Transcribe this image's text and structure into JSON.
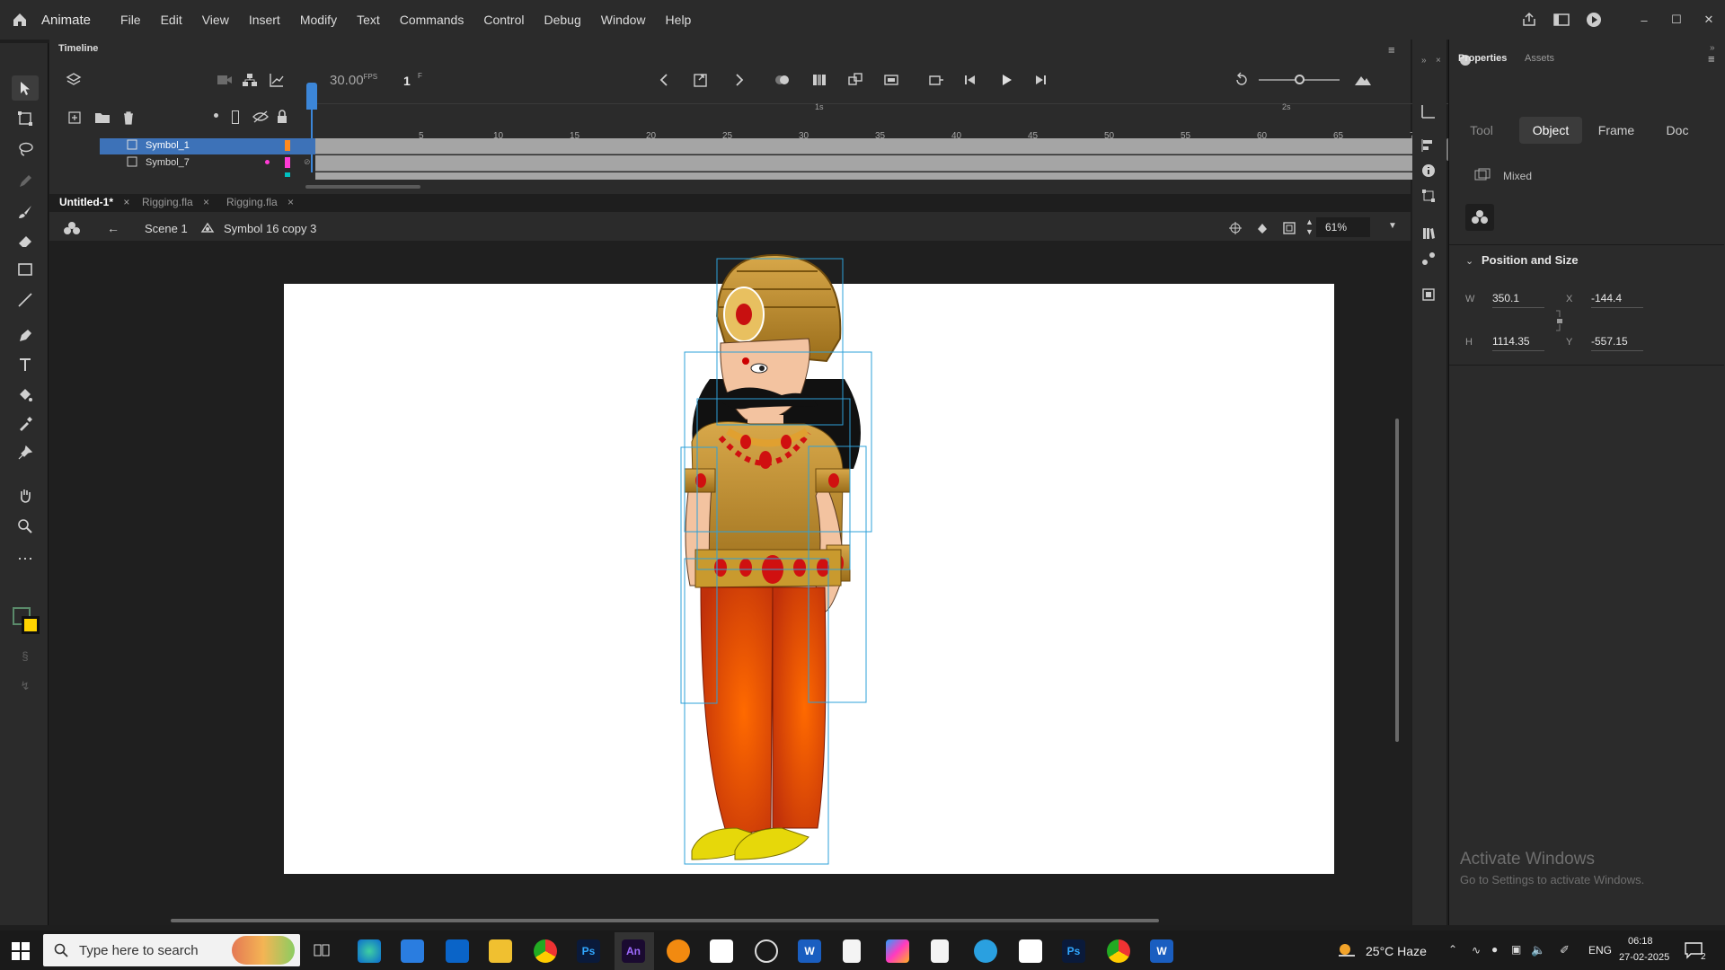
{
  "app": {
    "name": "Animate"
  },
  "menu": [
    "File",
    "Edit",
    "View",
    "Insert",
    "Modify",
    "Text",
    "Commands",
    "Control",
    "Debug",
    "Window",
    "Help"
  ],
  "timeline": {
    "panel_title": "Timeline",
    "fps": "30.00",
    "fps_unit": "FPS",
    "frame": "1",
    "frame_unit": "F",
    "ruler": [
      "5",
      "10",
      "15",
      "20",
      "25",
      "30",
      "35",
      "40",
      "45",
      "50",
      "55",
      "60",
      "65",
      "70"
    ],
    "seconds": [
      "1s",
      "2s"
    ],
    "layers": [
      {
        "name": "Symbol_1",
        "color": "#ff8a1f"
      },
      {
        "name": "Symbol_7",
        "color": "#ff3bd5"
      }
    ]
  },
  "doc_tabs": [
    {
      "label": "Untitled-1*"
    },
    {
      "label": "Rigging.fla"
    },
    {
      "label": "Rigging.fla"
    }
  ],
  "edit_bar": {
    "scene": "Scene 1",
    "symbol": "Symbol 16 copy 3",
    "zoom": "61%"
  },
  "properties": {
    "tabs": {
      "properties": "Properties",
      "assets": "Assets"
    },
    "subtabs": [
      "Tool",
      "Object",
      "Frame",
      "Doc"
    ],
    "selected_subtab": "Object",
    "instance": "Mixed",
    "section": "Position and Size",
    "w_label": "W",
    "w": "350.1",
    "h_label": "H",
    "h": "1114.35",
    "x_label": "X",
    "x": "-144.4",
    "y_label": "Y",
    "y": "-557.15"
  },
  "watermark": {
    "line1": "Activate Windows",
    "line2": "Go to Settings to activate Windows."
  },
  "taskbar": {
    "search_placeholder": "Type here to search",
    "weather": "25°C  Haze",
    "lang": "ENG",
    "time": "06:18",
    "date": "27-02-2025",
    "notifications": "2"
  }
}
